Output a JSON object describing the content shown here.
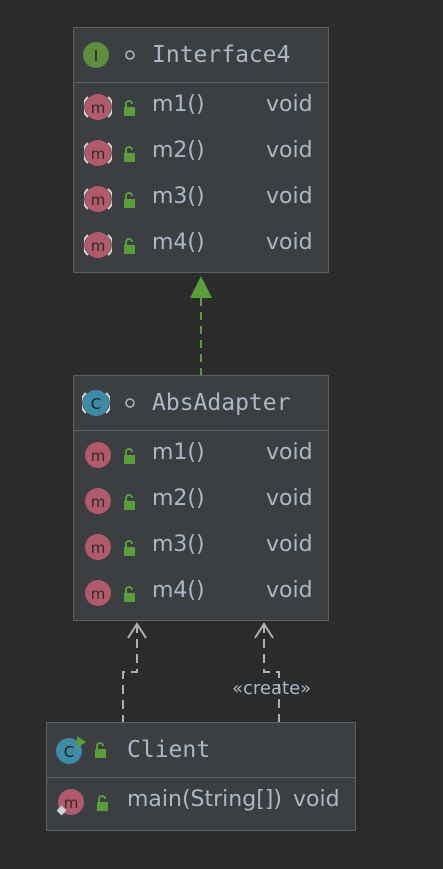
{
  "interface4": {
    "kind_letter": "I",
    "name": "Interface4",
    "methods": [
      {
        "name": "m1()",
        "type": "void"
      },
      {
        "name": "m2()",
        "type": "void"
      },
      {
        "name": "m3()",
        "type": "void"
      },
      {
        "name": "m4()",
        "type": "void"
      }
    ]
  },
  "abs_adapter": {
    "kind_letter": "C",
    "name": "AbsAdapter",
    "methods": [
      {
        "name": "m1()",
        "type": "void"
      },
      {
        "name": "m2()",
        "type": "void"
      },
      {
        "name": "m3()",
        "type": "void"
      },
      {
        "name": "m4()",
        "type": "void"
      }
    ]
  },
  "client": {
    "kind_letter": "C",
    "name": "Client",
    "methods": [
      {
        "name": "main(String[])",
        "type": "void"
      }
    ]
  },
  "method_letter": "m",
  "create_label": "«create»",
  "colors": {
    "background": "#2b2b2b",
    "box": "#3c3f41",
    "border": "#5e6163",
    "text": "#a9b7c6",
    "interface_icon": "#5e8d3e",
    "class_icon": "#3e8ba8",
    "method_icon": "#b05a6c",
    "lock": "#5a9e3a",
    "implements_edge": "#5a9e3a",
    "dependency_edge": "#b0b0b0"
  }
}
